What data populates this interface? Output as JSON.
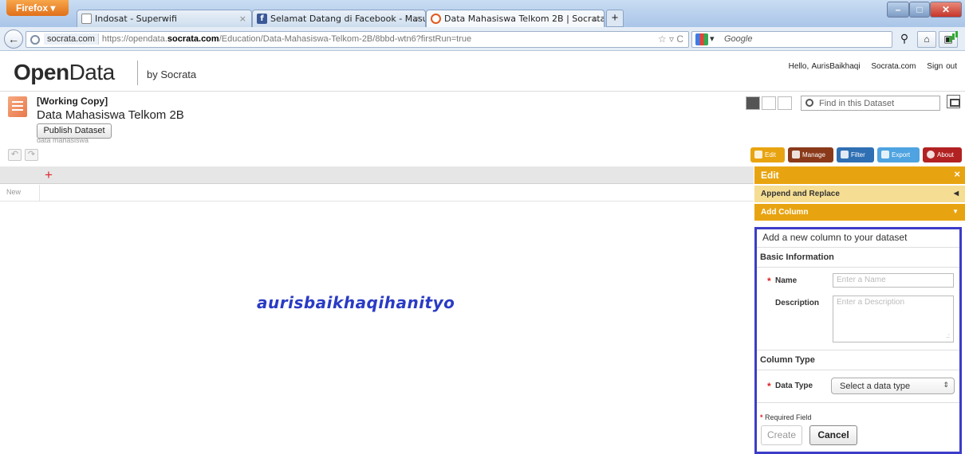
{
  "browser": {
    "firefox_label": "Firefox",
    "tabs": [
      {
        "title": "Indosat - Superwifi"
      },
      {
        "title": "Selamat Datang di Facebook - Masuk..."
      },
      {
        "title": "Data Mahasiswa Telkom 2B | Socrata"
      }
    ],
    "newtab_label": "+",
    "url_site": "socrata.com",
    "url_prefix": "https://opendata.",
    "url_domain": "socrata.com",
    "url_path": "/Education/Data-Mahasiswa-Telkom-2B/8bbd-wtn6?firstRun=true",
    "search_placeholder": "Google"
  },
  "header": {
    "logo_open": "Open",
    "logo_data": "Data",
    "by": "by Socrata",
    "hello": "Hello, AurisBaikhaqi",
    "socrata_link": "Socrata.com",
    "signout": "Sign out"
  },
  "dataset": {
    "working_copy": "[Working Copy]",
    "title": "Data Mahasiswa Telkom 2B",
    "publish_button": "Publish Dataset",
    "description": "data mahasiswa",
    "find_placeholder": "Find in this Dataset"
  },
  "toolbar": {
    "edit": "Edit",
    "manage": "Manage",
    "filter": "Filter",
    "export": "Export",
    "about": "About",
    "colors": {
      "edit": "#e8a410",
      "manage": "#8a3a1a",
      "filter": "#2f6fb4",
      "export": "#4ea3e0",
      "about": "#b22222"
    }
  },
  "grid": {
    "add_symbol": "+",
    "new_row_label": "New"
  },
  "watermark": "aurisbaikhaqihanityo",
  "panel": {
    "edit_title": "Edit",
    "close": "×",
    "append_replace": "Append and Replace",
    "add_column": "Add Column",
    "intro": "Add a new column to your dataset",
    "basic_info": "Basic Information",
    "name_label": "Name",
    "name_placeholder": "Enter a Name",
    "description_label": "Description",
    "description_placeholder": "Enter a Description",
    "column_type": "Column Type",
    "data_type_label": "Data Type",
    "data_type_value": "Select a data type",
    "required_field": "Required Field",
    "create": "Create",
    "cancel": "Cancel"
  }
}
